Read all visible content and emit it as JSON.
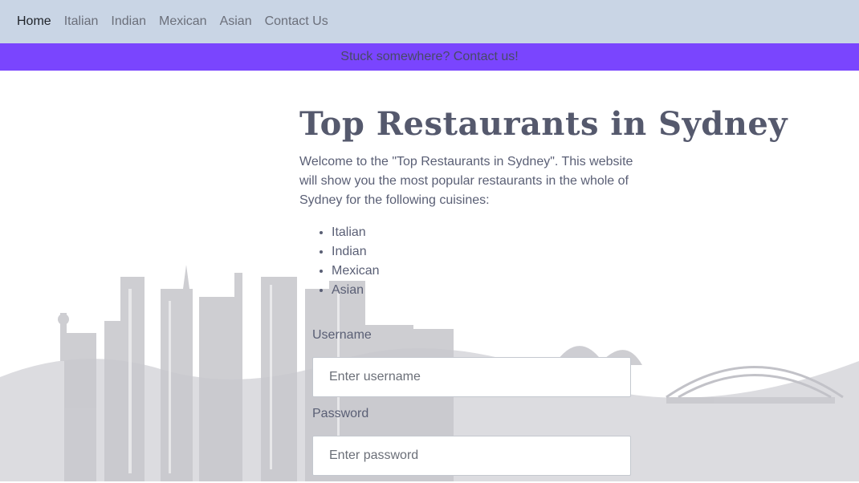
{
  "nav": {
    "items": [
      {
        "label": "Home",
        "active": true
      },
      {
        "label": "Italian"
      },
      {
        "label": "Indian"
      },
      {
        "label": "Mexican"
      },
      {
        "label": "Asian"
      },
      {
        "label": "Contact Us"
      }
    ]
  },
  "banner": {
    "text": "Stuck somewhere? Contact us!",
    "background": "#7a45fe"
  },
  "main": {
    "title": "Top Restaurants in Sydney",
    "intro": "Welcome to the \"Top Restaurants in Sydney\". This website will show you the most popular restaurants in the whole of Sydney for the following cuisines:",
    "cuisines": [
      "Italian",
      "Indian",
      "Mexican",
      "Asian"
    ]
  },
  "form": {
    "username_label": "Username",
    "username_placeholder": "Enter username",
    "password_label": "Password",
    "password_placeholder": "Enter password"
  },
  "colors": {
    "navbar": "#c9d5e5",
    "banner": "#7a45fe",
    "text": "#5a5f75"
  }
}
